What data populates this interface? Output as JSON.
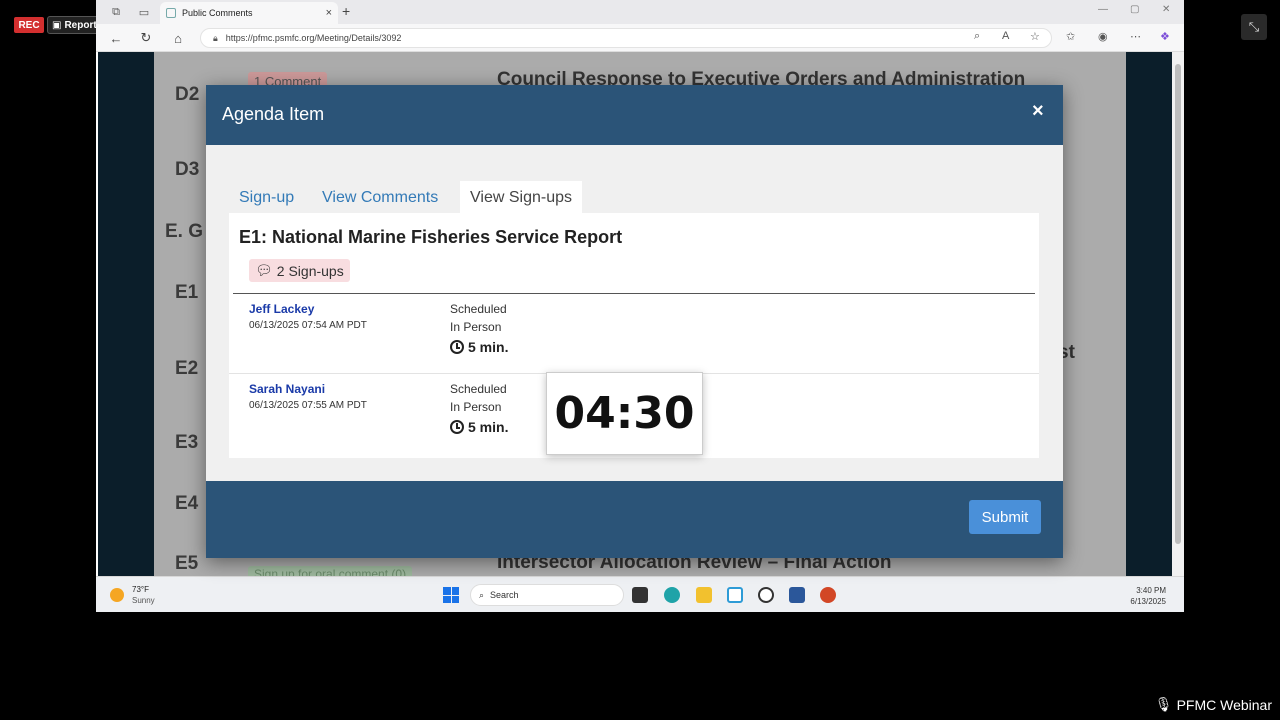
{
  "overlay": {
    "rec_label": "REC",
    "report_label": "Report",
    "webinar_label": "PFMC Webinar"
  },
  "browser": {
    "tab_title": "Public Comments",
    "url": "https://pfmc.psmfc.org/Meeting/Details/3092"
  },
  "background_page": {
    "rows": [
      {
        "num": "D2",
        "comment": "1 Comment",
        "title": "Council Response to Executive Orders and Administration"
      },
      {
        "num": "D3"
      },
      {
        "num": "E. G"
      },
      {
        "num": "E1"
      },
      {
        "num": "E2",
        "partial": "st"
      },
      {
        "num": "E3"
      },
      {
        "num": "E4"
      },
      {
        "num": "E5",
        "ghost": "Sign up for oral comment (0)",
        "title": "Intersector Allocation Review – Final Action"
      }
    ]
  },
  "modal": {
    "title": "Agenda Item",
    "close_glyph": "×",
    "tabs": [
      "Sign-up",
      "View Comments",
      "View Sign-ups"
    ],
    "active_tab": "View Sign-ups",
    "item_title": "E1: National Marine Fisheries Service Report",
    "signup_count": "2 Sign-ups",
    "signups": [
      {
        "name": "Jeff Lackey",
        "datetime": "06/13/2025 07:54 AM PDT",
        "status": "Scheduled",
        "mode": "In Person",
        "duration": "5 min."
      },
      {
        "name": "Sarah Nayani",
        "datetime": "06/13/2025 07:55 AM PDT",
        "status": "Scheduled",
        "mode": "In Person",
        "duration": "5 min."
      }
    ],
    "submit_label": "Submit"
  },
  "timer": {
    "value": "04:30"
  },
  "taskbar": {
    "weather_temp": "73°F",
    "weather_cond": "Sunny",
    "search_placeholder": "Search",
    "time": "3:40 PM",
    "date": "6/13/2025"
  },
  "colors": {
    "modal_header": "#2b5478",
    "submit_button": "#4a90d9",
    "tab_link": "#337ab7",
    "signup_badge": "#f8dde0"
  }
}
